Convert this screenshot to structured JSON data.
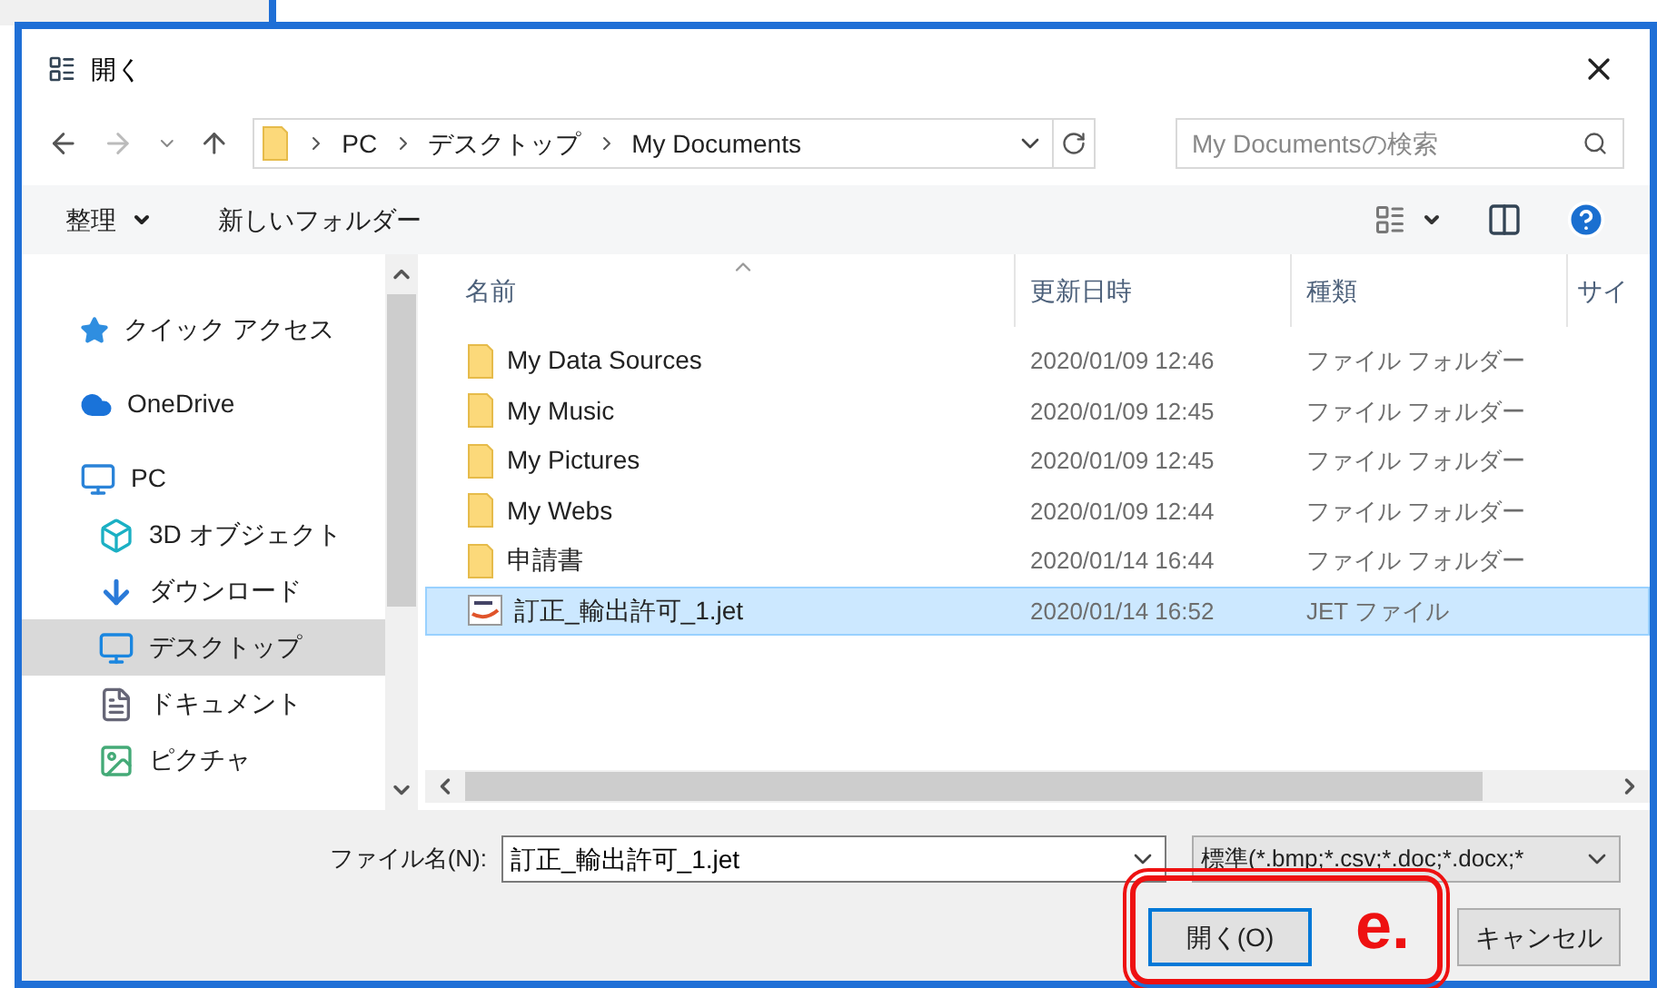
{
  "window": {
    "title": "開く"
  },
  "address": {
    "crumbs": [
      "PC",
      "デスクトップ",
      "My Documents"
    ],
    "search_placeholder": "My Documentsの検索"
  },
  "toolbar": {
    "organize": "整理",
    "new_folder": "新しいフォルダー"
  },
  "nav_pane": {
    "items": [
      {
        "label": "クイック アクセス",
        "kind": "star",
        "selected": false
      },
      {
        "label": "OneDrive",
        "kind": "cloud",
        "selected": false
      },
      {
        "label": "PC",
        "kind": "pc",
        "selected": false,
        "children": [
          {
            "label": "3D オブジェクト",
            "kind": "cube",
            "selected": false
          },
          {
            "label": "ダウンロード",
            "kind": "download",
            "selected": false
          },
          {
            "label": "デスクトップ",
            "kind": "desktop",
            "selected": true
          },
          {
            "label": "ドキュメント",
            "kind": "document",
            "selected": false
          },
          {
            "label": "ピクチャ",
            "kind": "picture",
            "selected": false
          }
        ]
      }
    ]
  },
  "file_list": {
    "columns": [
      "名前",
      "更新日時",
      "種類",
      "サイ"
    ],
    "rows": [
      {
        "name": "My Data Sources",
        "date": "2020/01/09 12:46",
        "type": "ファイル フォルダー",
        "kind": "folder",
        "selected": false
      },
      {
        "name": "My Music",
        "date": "2020/01/09 12:45",
        "type": "ファイル フォルダー",
        "kind": "folder",
        "selected": false
      },
      {
        "name": "My Pictures",
        "date": "2020/01/09 12:45",
        "type": "ファイル フォルダー",
        "kind": "folder",
        "selected": false
      },
      {
        "name": "My Webs",
        "date": "2020/01/09 12:44",
        "type": "ファイル フォルダー",
        "kind": "folder",
        "selected": false
      },
      {
        "name": "申請書",
        "date": "2020/01/14 16:44",
        "type": "ファイル フォルダー",
        "kind": "folder",
        "selected": false
      },
      {
        "name": "訂正_輸出許可_1.jet",
        "date": "2020/01/14 16:52",
        "type": "JET ファイル",
        "kind": "file",
        "selected": true
      }
    ]
  },
  "file_name": {
    "label": "ファイル名(N):",
    "value": "訂正_輸出許可_1.jet"
  },
  "file_type": {
    "value": "標準(*.bmp;*.csv;*.doc;*.docx;*"
  },
  "buttons": [
    {
      "label": "開く(O)",
      "kind": "primary"
    },
    {
      "label": "キャンセル",
      "kind": "normal"
    }
  ],
  "annotation": {
    "label": "e."
  }
}
